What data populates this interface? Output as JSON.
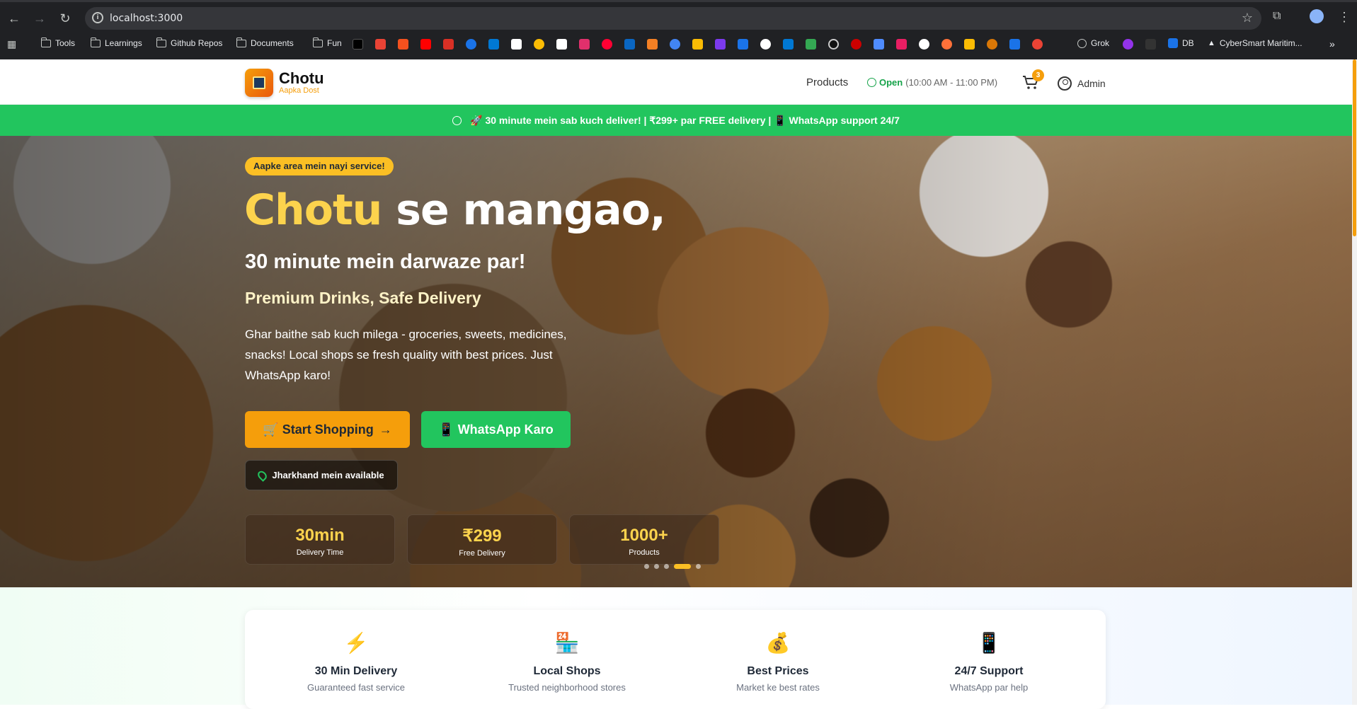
{
  "browser": {
    "url": "localhost:3000",
    "bookmarks": [
      "Tools",
      "Learnings",
      "Github Repos",
      "Documents",
      "Fun",
      "Grok",
      "DB",
      "CyberSmart Maritim..."
    ],
    "favicons": [
      "x-icon",
      "gmail-icon",
      "git-icon",
      "youtube-icon",
      "bookmark-red-icon",
      "play-blue-icon",
      "bing-icon",
      "amazon-icon",
      "chrome-icon",
      "grid-icon",
      "instagram-icon",
      "youtube-music-icon",
      "linkedin-icon",
      "stack-icon",
      "circle-blue-icon",
      "product-hunt-icon",
      "wave-icon",
      "blue-box-icon",
      "openai-icon",
      "outlook-icon",
      "green-box-icon",
      "dark-circle-icon",
      "red-circle-icon",
      "gemini-icon",
      "mail-red-icon",
      "github-icon",
      "firefox-icon",
      "yellow-box-icon",
      "star-icon",
      "diamond-icon"
    ],
    "more": "»"
  },
  "header": {
    "brand": "Chotu",
    "tagline": "Aapka Dost",
    "nav_products": "Products",
    "status_open": "Open",
    "status_hours": "(10:00 AM - 11:00 PM)",
    "cart_count": "3",
    "admin": "Admin"
  },
  "promo": {
    "text": "🚀 30 minute mein sab kuch deliver! | ₹299+ par FREE delivery | 📱 WhatsApp support 24/7"
  },
  "hero": {
    "badge": "Aapke area mein nayi service!",
    "title_highlight": "Chotu",
    "title_rest": " se mangao,",
    "subtitle": "30 minute mein darwaze par!",
    "subtitle2": "Premium Drinks, Safe Delivery",
    "description": "Ghar baithe sab kuch milega - groceries, sweets, medicines, snacks! Local shops se fresh quality with best prices. Just WhatsApp karo!",
    "btn_shop": "🛒 Start Shopping",
    "btn_whatsapp": "📱 WhatsApp Karo",
    "location": "Jharkhand mein available",
    "stats": [
      {
        "value": "30min",
        "label": "Delivery Time"
      },
      {
        "value": "₹299",
        "label": "Free Delivery"
      },
      {
        "value": "1000+",
        "label": "Products"
      }
    ],
    "slides_total": 5,
    "slide_active": 4
  },
  "features": [
    {
      "icon": "⚡",
      "title": "30 Min Delivery",
      "desc": "Guaranteed fast service"
    },
    {
      "icon": "🏪",
      "title": "Local Shops",
      "desc": "Trusted neighborhood stores"
    },
    {
      "icon": "💰",
      "title": "Best Prices",
      "desc": "Market ke best rates"
    },
    {
      "icon": "📱",
      "title": "24/7 Support",
      "desc": "WhatsApp par help"
    }
  ],
  "colors": {
    "accent": "#f59e0b",
    "green": "#22c55e",
    "highlight": "#fcd34d"
  }
}
